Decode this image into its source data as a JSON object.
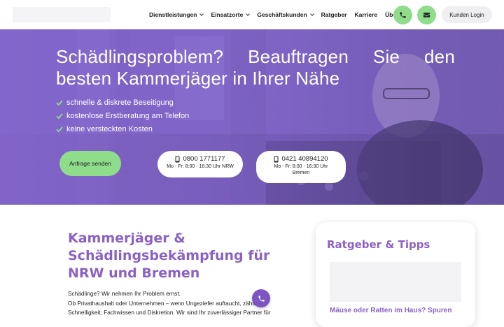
{
  "nav": {
    "items": [
      {
        "label": "Dienstleistungen",
        "dropdown": true
      },
      {
        "label": "Einsatzorte",
        "dropdown": true
      },
      {
        "label": "Geschäftskunden",
        "dropdown": true
      },
      {
        "label": "Ratgeber",
        "dropdown": false
      },
      {
        "label": "Karriere",
        "dropdown": false
      },
      {
        "label": "Über uns",
        "dropdown": false
      }
    ],
    "phone_icon": "phone-icon",
    "mail_icon": "envelope-icon",
    "login_label": "Kunden Login"
  },
  "hero": {
    "title": "Schädlingsproblem? Beauftragen Sie den besten Kammerjäger in Ihrer Nähe",
    "checks": [
      "schnelle & diskrete Beseitigung",
      "kostenlose Erstberatung am Telefon",
      "keine versteckten Kosten"
    ],
    "cta_label": "Anfrage senden",
    "phones": [
      {
        "number": "0800 1771177",
        "hours": "Mo - Fr: 8:00 - 16:30 Uhr NRW"
      },
      {
        "number": "0421 40894120",
        "hours": "Mo - Fr: 8:00 - 16:30 Uhr Bremen"
      }
    ]
  },
  "main": {
    "title": "Kammerjäger & Schädlingsbekämpfung für NRW und Bremen",
    "lines": [
      "Schädlinge? Wir nehmen Ihr Problem ernst.",
      "Ob Privathaushalt oder Unternehmen – wenn Ungeziefer auftaucht, zählen",
      "Schnelligkeit, Fachwissen und Diskretion. Wir sind Ihr zuverlässiger Partner für"
    ]
  },
  "sidebar": {
    "title": "Ratgeber & Tipps",
    "article_title": "Mäuse oder Ratten im Haus? Spuren"
  },
  "colors": {
    "accent_purple": "#8b62c4",
    "accent_green": "#8fdc8b",
    "floating_button": "#7c55c2"
  }
}
